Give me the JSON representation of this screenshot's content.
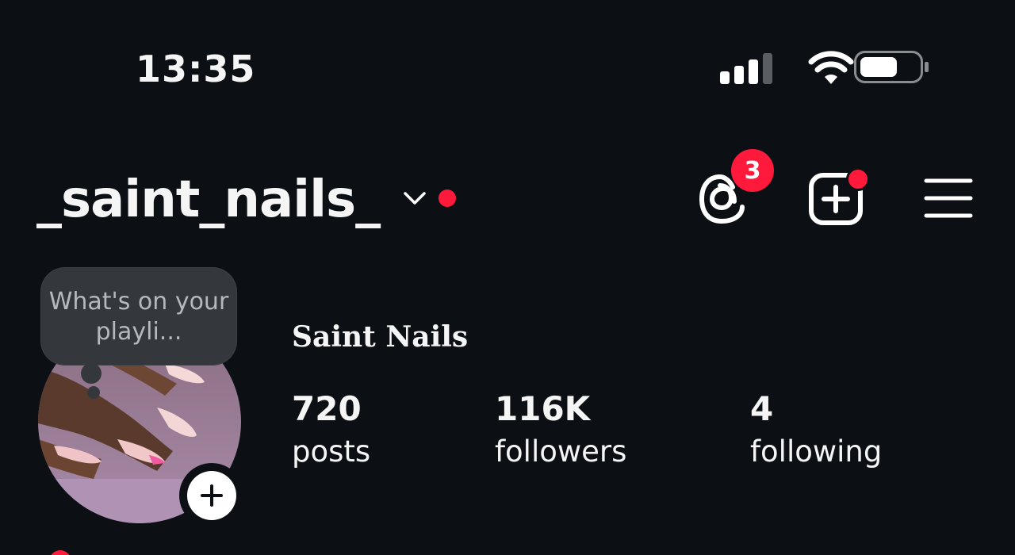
{
  "status_bar": {
    "time": "13:35",
    "icons": [
      "cellular-signal-icon",
      "wifi-icon",
      "battery-icon"
    ]
  },
  "header": {
    "username": "_saint_nails_",
    "account_switcher_icon": "chevron-down-icon",
    "threads_badge_count": "3",
    "actions": [
      "threads-icon",
      "create-plus-icon",
      "hamburger-menu-icon"
    ]
  },
  "profile": {
    "note_text": "What's on your playli...",
    "display_name": "Saint Nails",
    "stats": {
      "posts": {
        "value": "720",
        "label": "posts"
      },
      "followers": {
        "value": "116K",
        "label": "followers"
      },
      "following": {
        "value": "4",
        "label": "following"
      }
    }
  },
  "colors": {
    "background": "#0c1014",
    "notification_red": "#ff1a3c",
    "text": "#f5f5f5",
    "note_bubble": "#34383c"
  }
}
